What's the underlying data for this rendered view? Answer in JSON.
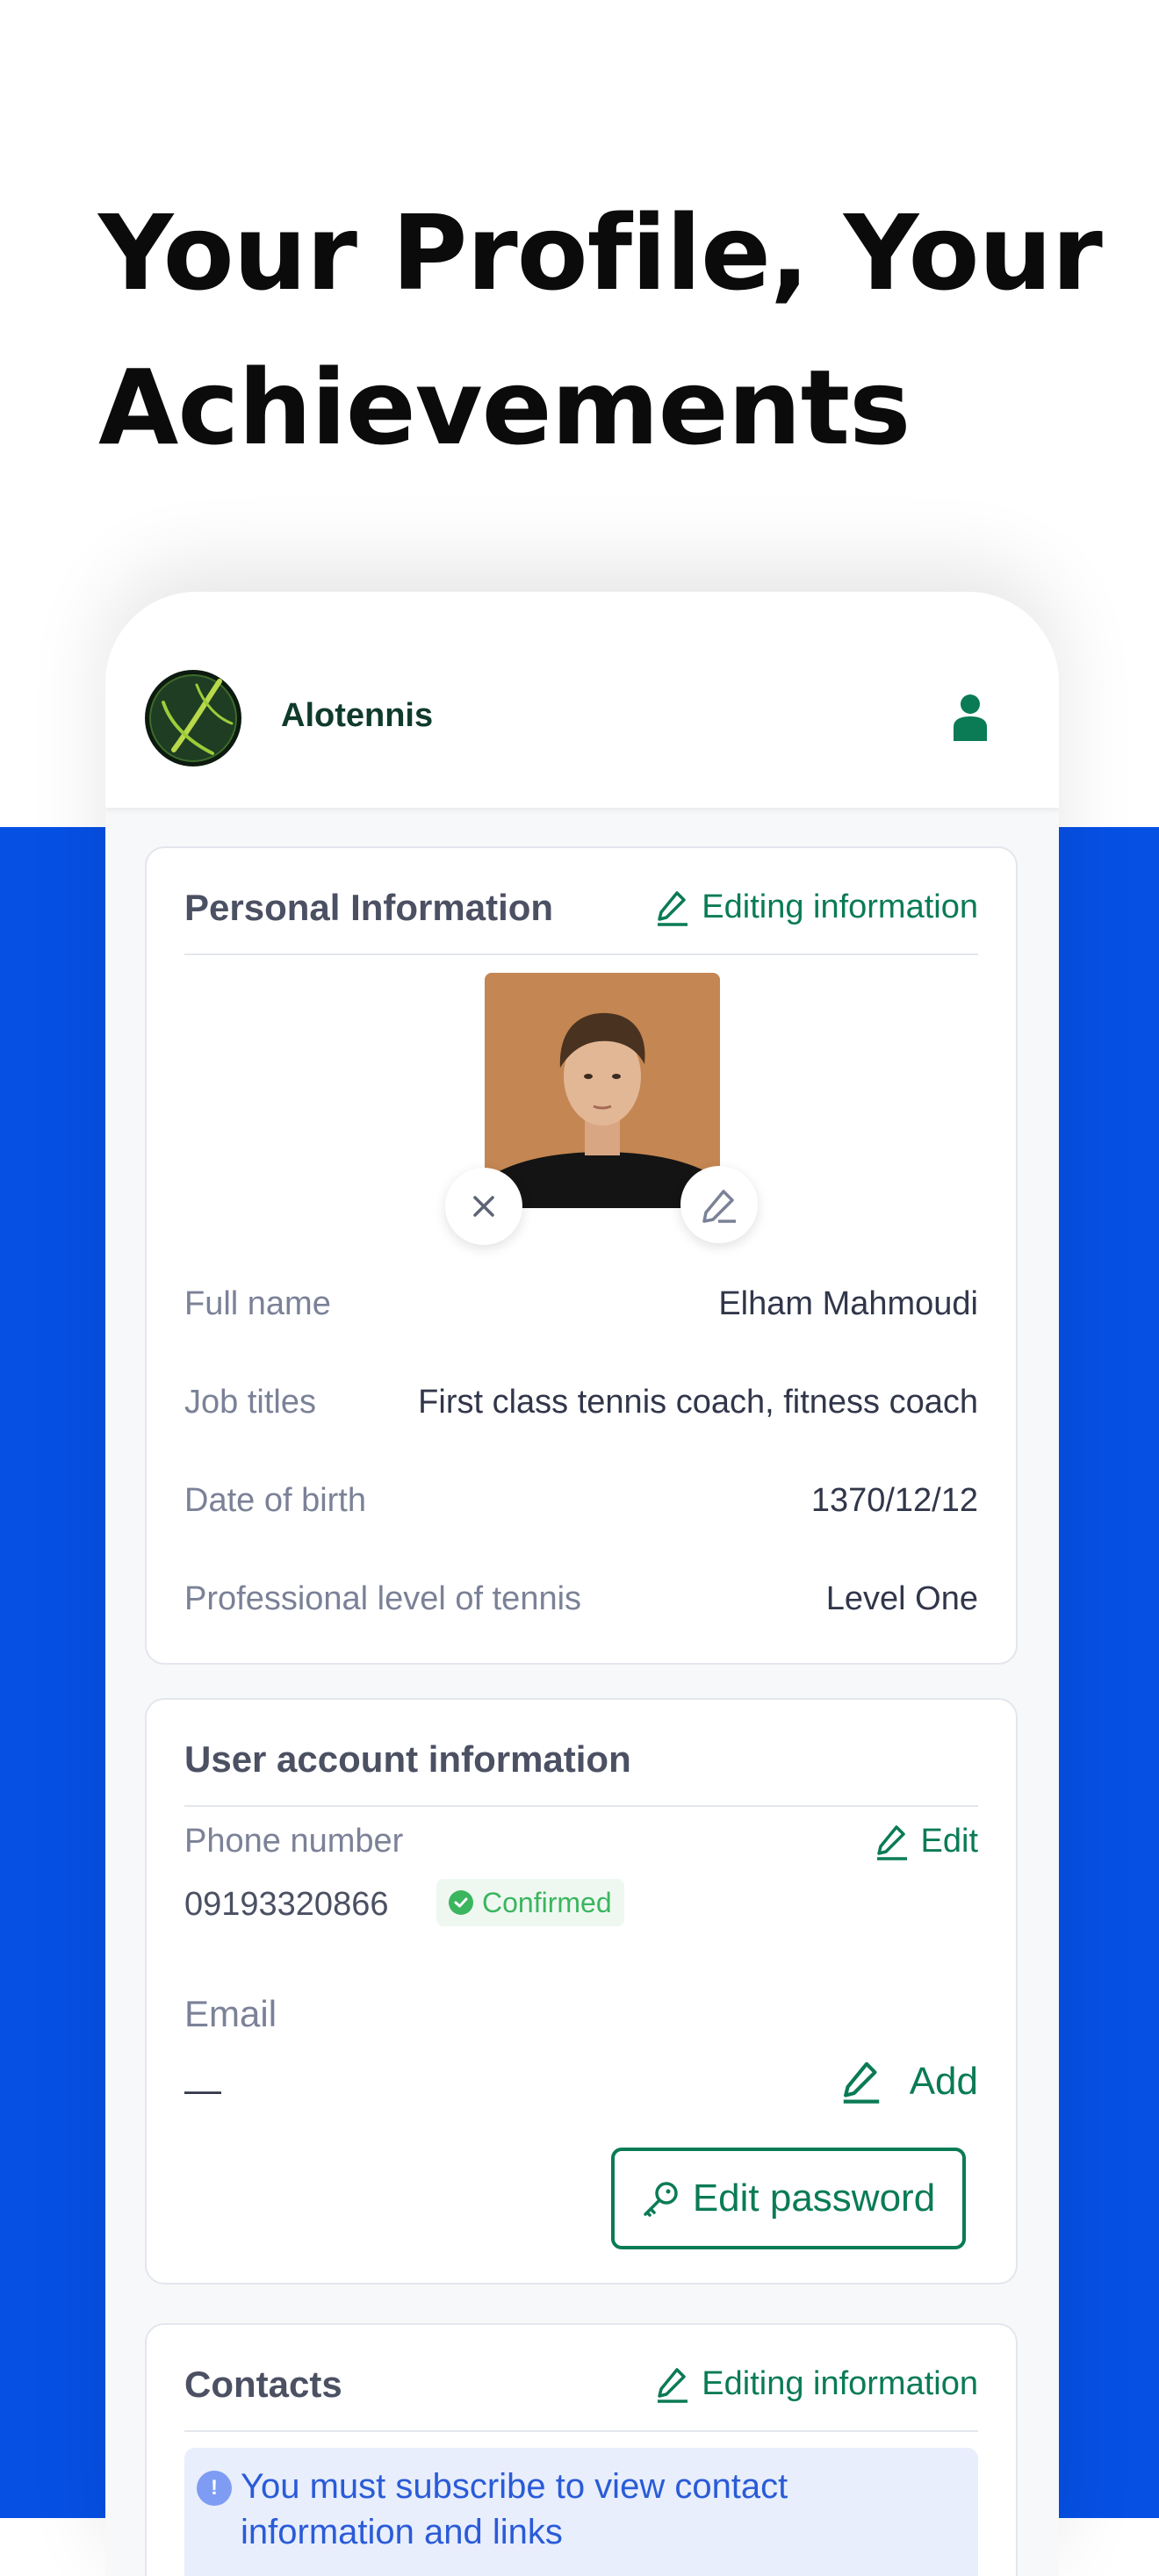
{
  "headline": {
    "line1": "Your Profile, Your",
    "line2": "Achievements"
  },
  "app": {
    "brand": "Alotennis"
  },
  "colors": {
    "primary_green": "#0a7b55",
    "brand_blue": "#0650E4",
    "confirmed_green": "#3cb55f",
    "notice_blue": "#2a5bd7"
  },
  "personal": {
    "title": "Personal Information",
    "edit_label": "Editing information",
    "rows": [
      {
        "label": "Full name",
        "value": "Elham Mahmoudi"
      },
      {
        "label": "Job titles",
        "value": "First class tennis coach, fitness coach"
      },
      {
        "label": "Date of birth",
        "value": "1370/12/12"
      },
      {
        "label": "Professional level of tennis",
        "value": "Level One"
      }
    ]
  },
  "account": {
    "title": "User account information",
    "phone_label": "Phone number",
    "phone_edit": "Edit",
    "phone_value": "09193320866",
    "phone_status": "Confirmed",
    "email_label": "Email",
    "email_value": "—",
    "email_add": "Add",
    "password_button": "Edit password"
  },
  "contacts": {
    "title": "Contacts",
    "edit_label": "Editing information",
    "notice_icon": "!",
    "notice": "You must subscribe to view contact information and links"
  }
}
